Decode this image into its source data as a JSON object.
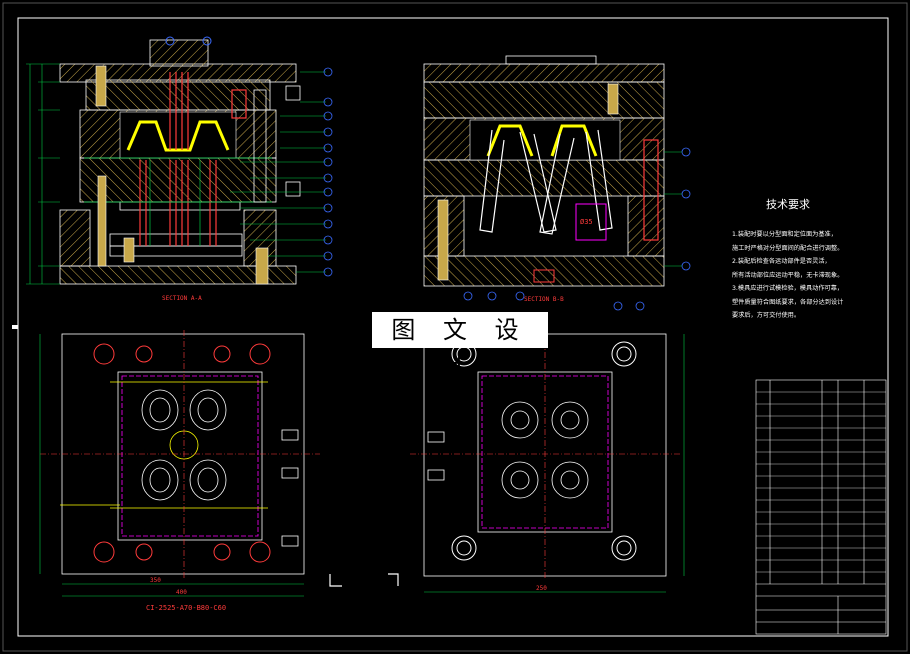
{
  "watermark": "图 文 设 计",
  "tech_requirements": {
    "title": "技术要求",
    "lines": [
      "1.装配时要以分型面和定位面为基准，",
      "施工时严格对分型面间的配合进行调整。",
      "2.装配后检查各运动部件是否灵活，",
      "所有活动部位应运动平稳，无卡滞现象。",
      "3.模具应进行试模检验，模具动作可靠，",
      "塑件质量符合图纸要求，各部分达到设计",
      "要求后，方可交付使用。"
    ]
  },
  "section_labels": {
    "front": "SECTION A-A",
    "side": "SECTION B-B",
    "bottom_left": "CI-2525-A70-B80-C60"
  },
  "dimensions": {
    "bottom_left_a": "350",
    "bottom_left_b": "400",
    "bottom_right": "250"
  },
  "tags": {
    "dia": "Ø35"
  },
  "colors": {
    "background": "#000000",
    "frame": "#ffffff",
    "hatch": "#c8a84a",
    "cavity": "#ffff00",
    "outline": "#ffffff",
    "red": "#ff3b3b",
    "green": "#00cc44",
    "magenta": "#ff00ff",
    "cyan": "#00d0ff",
    "blue": "#3a6bff",
    "orange": "#ff8a00"
  }
}
